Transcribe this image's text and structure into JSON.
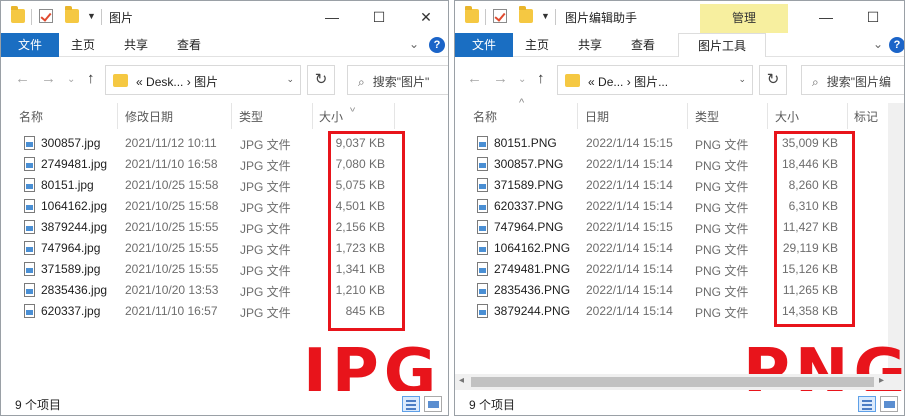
{
  "accent_color": "#1a6ec2",
  "highlight_color": "#e8141b",
  "left_window": {
    "title": "图片",
    "ribbon": {
      "file_tab": "文件",
      "tabs": [
        "主页",
        "共享",
        "查看"
      ]
    },
    "address": {
      "path_prefix": "«",
      "path": "Desk...",
      "separator": "›",
      "current": "图片"
    },
    "search_placeholder": "搜索\"图片\"",
    "columns": {
      "name": "名称",
      "date": "修改日期",
      "type": "类型",
      "size": "大小"
    },
    "files": [
      {
        "name": "300857.jpg",
        "date": "2021/11/12 10:11",
        "type": "JPG 文件",
        "size": "9,037 KB"
      },
      {
        "name": "2749481.jpg",
        "date": "2021/11/10 16:58",
        "type": "JPG 文件",
        "size": "7,080 KB"
      },
      {
        "name": "80151.jpg",
        "date": "2021/10/25 15:58",
        "type": "JPG 文件",
        "size": "5,075 KB"
      },
      {
        "name": "1064162.jpg",
        "date": "2021/10/25 15:58",
        "type": "JPG 文件",
        "size": "4,501 KB"
      },
      {
        "name": "3879244.jpg",
        "date": "2021/10/25 15:55",
        "type": "JPG 文件",
        "size": "2,156 KB"
      },
      {
        "name": "747964.jpg",
        "date": "2021/10/25 15:55",
        "type": "JPG 文件",
        "size": "1,723 KB"
      },
      {
        "name": "371589.jpg",
        "date": "2021/10/25 15:55",
        "type": "JPG 文件",
        "size": "1,341 KB"
      },
      {
        "name": "2835436.jpg",
        "date": "2021/10/20 13:53",
        "type": "JPG 文件",
        "size": "1,210 KB"
      },
      {
        "name": "620337.jpg",
        "date": "2021/11/10 16:57",
        "type": "JPG 文件",
        "size": "845 KB"
      }
    ],
    "status": "9 个项目",
    "big_label": "JPG"
  },
  "right_window": {
    "title": "图片编辑助手",
    "manage_tab": "管理",
    "ribbon": {
      "file_tab": "文件",
      "tabs": [
        "主页",
        "共享",
        "查看"
      ],
      "tool_tab": "图片工具"
    },
    "address": {
      "path_prefix": "«",
      "path": "De...",
      "separator": "›",
      "current": "图片..."
    },
    "search_placeholder": "搜索\"图片编",
    "columns": {
      "name": "名称",
      "date": "日期",
      "type": "类型",
      "size": "大小",
      "tags": "标记"
    },
    "files": [
      {
        "name": "80151.PNG",
        "date": "2022/1/14 15:15",
        "type": "PNG 文件",
        "size": "35,009 KB"
      },
      {
        "name": "300857.PNG",
        "date": "2022/1/14 15:14",
        "type": "PNG 文件",
        "size": "18,446 KB"
      },
      {
        "name": "371589.PNG",
        "date": "2022/1/14 15:14",
        "type": "PNG 文件",
        "size": "8,260 KB"
      },
      {
        "name": "620337.PNG",
        "date": "2022/1/14 15:14",
        "type": "PNG 文件",
        "size": "6,310 KB"
      },
      {
        "name": "747964.PNG",
        "date": "2022/1/14 15:15",
        "type": "PNG 文件",
        "size": "11,427 KB"
      },
      {
        "name": "1064162.PNG",
        "date": "2022/1/14 15:14",
        "type": "PNG 文件",
        "size": "29,119 KB"
      },
      {
        "name": "2749481.PNG",
        "date": "2022/1/14 15:14",
        "type": "PNG 文件",
        "size": "15,126 KB"
      },
      {
        "name": "2835436.PNG",
        "date": "2022/1/14 15:14",
        "type": "PNG 文件",
        "size": "11,265 KB"
      },
      {
        "name": "3879244.PNG",
        "date": "2022/1/14 15:14",
        "type": "PNG 文件",
        "size": "14,358 KB"
      }
    ],
    "status": "9 个项目",
    "big_label": "PNG"
  }
}
